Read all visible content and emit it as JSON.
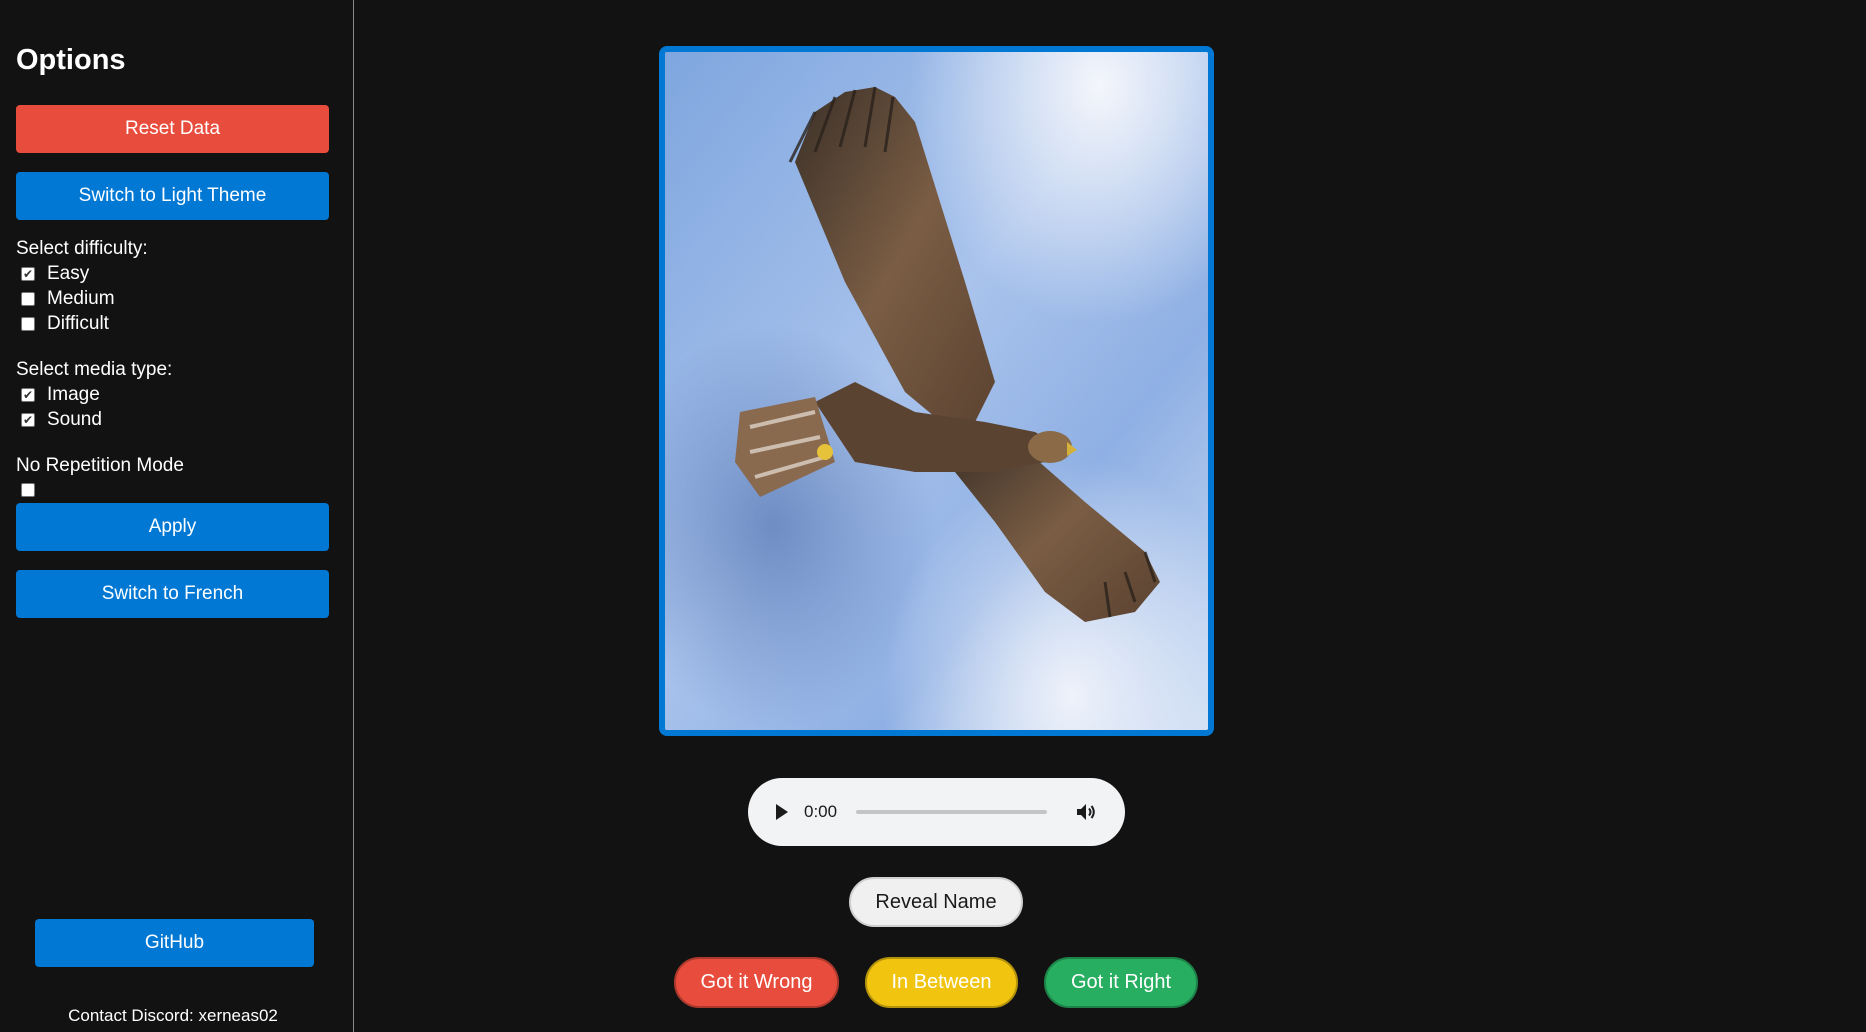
{
  "sidebar": {
    "title": "Options",
    "reset_label": "Reset Data",
    "theme_label": "Switch to Light Theme",
    "difficulty": {
      "label": "Select difficulty:",
      "options": [
        {
          "label": "Easy",
          "checked": true
        },
        {
          "label": "Medium",
          "checked": false
        },
        {
          "label": "Difficult",
          "checked": false
        }
      ]
    },
    "media_type": {
      "label": "Select media type:",
      "options": [
        {
          "label": "Image",
          "checked": true
        },
        {
          "label": "Sound",
          "checked": true
        }
      ]
    },
    "no_repetition": {
      "label": "No Repetition Mode",
      "checked": false
    },
    "apply_label": "Apply",
    "language_label": "Switch to French",
    "github_label": "GitHub",
    "contact": "Contact Discord: xerneas02"
  },
  "main": {
    "image_subject": "golden-eagle-in-flight",
    "audio": {
      "time": "0:00",
      "progress": 0
    },
    "reveal_label": "Reveal Name",
    "answers": {
      "wrong_label": "Got it Wrong",
      "between_label": "In Between",
      "right_label": "Got it Right"
    }
  },
  "colors": {
    "background": "#121212",
    "accent_blue": "#0078d4",
    "red": "#e74c3c",
    "yellow": "#f1c40f",
    "green": "#27ae60"
  }
}
